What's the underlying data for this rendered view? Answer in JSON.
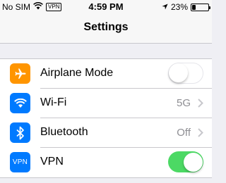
{
  "status_bar": {
    "carrier": "No SIM",
    "vpn": "VPN",
    "time": "4:59 PM",
    "battery_pct": "23%",
    "battery_level": 0.23
  },
  "nav": {
    "title": "Settings"
  },
  "rows": [
    {
      "label": "Airplane Mode",
      "icon": "airplane-icon",
      "icon_color": "#ff9500",
      "toggle": false
    },
    {
      "label": "Wi-Fi",
      "icon": "wifi-icon",
      "icon_color": "#007aff",
      "value": "5G"
    },
    {
      "label": "Bluetooth",
      "icon": "bluetooth-icon",
      "icon_color": "#007aff",
      "value": "Off"
    },
    {
      "label": "VPN",
      "icon": "vpn-icon",
      "icon_text": "VPN",
      "icon_color": "#007aff",
      "toggle": true
    }
  ],
  "colors": {
    "toggle_on": "#4cd964",
    "chevron": "#c7c7cc"
  }
}
